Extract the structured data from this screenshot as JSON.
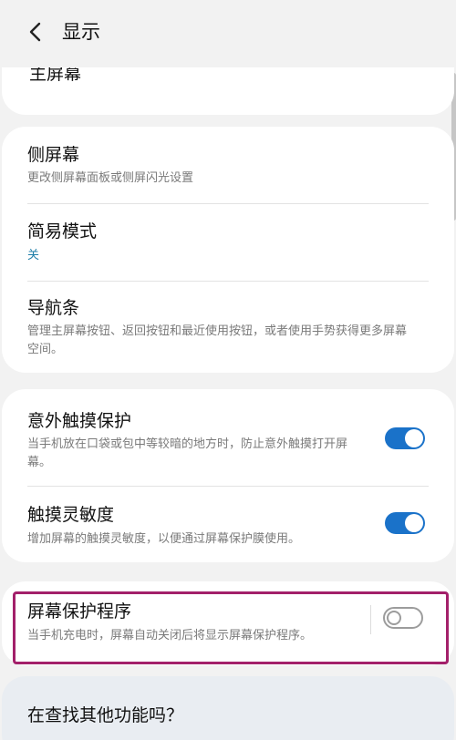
{
  "header": {
    "title": "显示",
    "back_icon": "chevron-left-icon"
  },
  "partial_item": {
    "title": "主屏幕"
  },
  "card1": {
    "items": [
      {
        "title": "侧屏幕",
        "subtitle": "更改侧屏幕面板或侧屏闪光设置"
      },
      {
        "title": "简易模式",
        "subtitle": "关"
      },
      {
        "title": "导航条",
        "subtitle": "管理主屏幕按钮、返回按钮和最近使用按钮，或者使用手势获得更多屏幕空间。"
      }
    ]
  },
  "card2": {
    "items": [
      {
        "title": "意外触摸保护",
        "subtitle": "当手机放在口袋或包中等较暗的地方时，防止意外触摸打开屏幕。",
        "toggle": "on"
      },
      {
        "title": "触摸灵敏度",
        "subtitle": "增加屏幕的触摸灵敏度，以便通过屏幕保护膜使用。",
        "toggle": "on"
      }
    ]
  },
  "card3": {
    "items": [
      {
        "title": "屏幕保护程序",
        "subtitle": "当手机充电时，屏幕自动关闭后将显示屏幕保护程序。",
        "toggle": "off"
      }
    ]
  },
  "suggestions": {
    "title": "在查找其他功能吗？"
  },
  "colors": {
    "accent": "#1a72c9",
    "link_accent": "#1f7ea8",
    "highlight": "#a3206a",
    "background": "#f2f2f2"
  }
}
